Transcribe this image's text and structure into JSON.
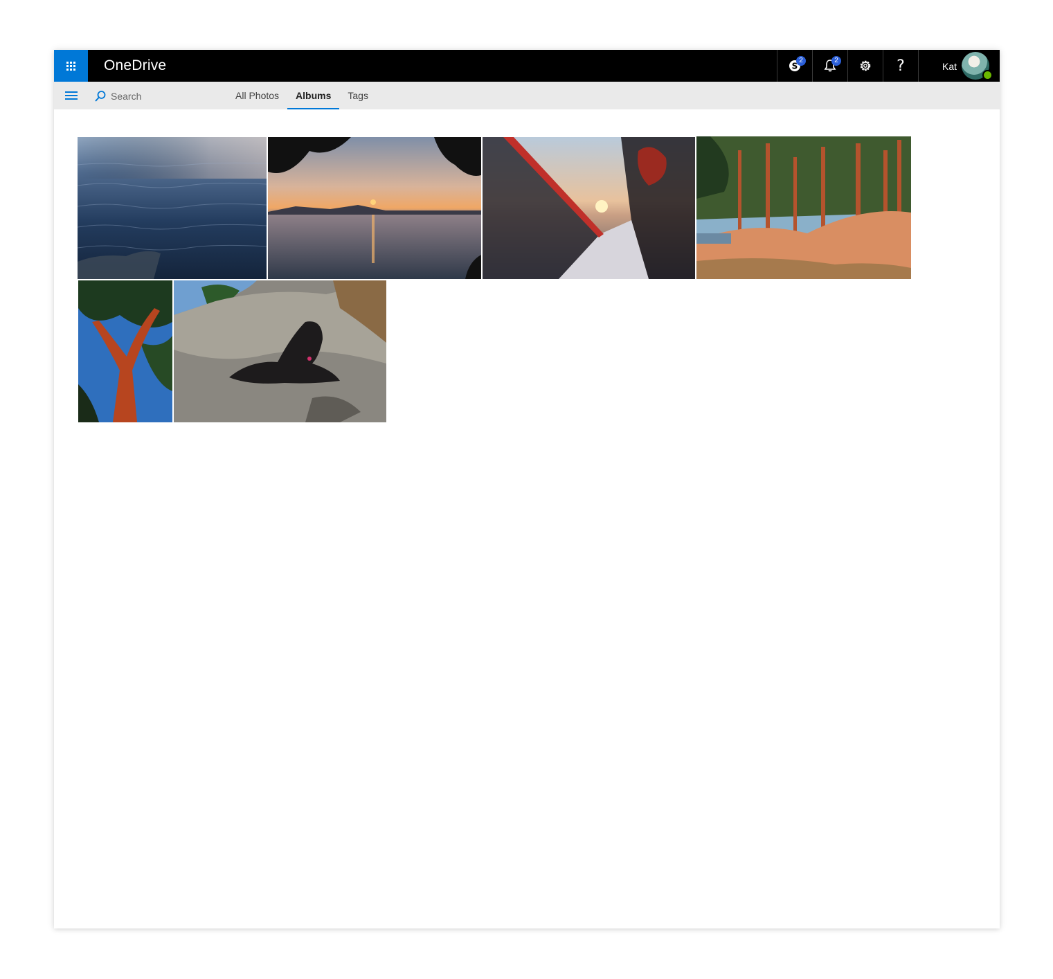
{
  "app": {
    "brand": "OneDrive"
  },
  "header": {
    "skype_badge": "2",
    "notifications_badge": "2",
    "help_label": "?",
    "user_name": "Kat"
  },
  "commandbar": {
    "search_placeholder": "Search",
    "tabs": [
      {
        "label": "All Photos",
        "active": false
      },
      {
        "label": "Albums",
        "active": true
      },
      {
        "label": "Tags",
        "active": false
      }
    ]
  },
  "colors": {
    "accent": "#0078d7",
    "topbar": "#000000",
    "commandbar": "#eaeaea",
    "badge": "#2b5fd9",
    "presence": "#6bb700"
  },
  "albums": [
    {
      "subject": "ocean-water",
      "icon": "photo-thumbnail"
    },
    {
      "subject": "sunset-over-water",
      "icon": "photo-thumbnail"
    },
    {
      "subject": "tent-at-sunset",
      "icon": "photo-thumbnail"
    },
    {
      "subject": "pine-trees-on-rocks",
      "icon": "photo-thumbnail"
    },
    {
      "subject": "arbutus-tree",
      "icon": "photo-thumbnail"
    },
    {
      "subject": "dog-on-rock",
      "icon": "photo-thumbnail"
    }
  ]
}
